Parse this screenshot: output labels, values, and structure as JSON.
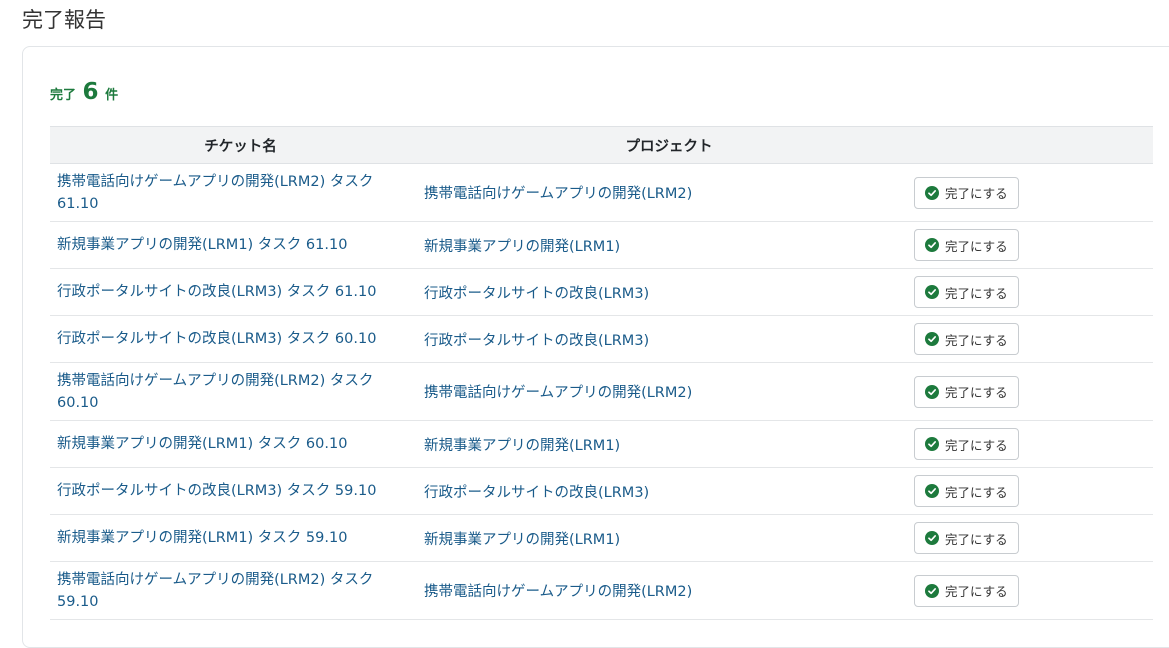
{
  "page": {
    "title": "完了報告"
  },
  "summary": {
    "prefix": "完了",
    "count": "6",
    "suffix": "件"
  },
  "table": {
    "headers": {
      "ticket": "チケット名",
      "project": "プロジェクト",
      "action": ""
    },
    "rows": [
      {
        "ticket": "携帯電話向けゲームアプリの開発(LRM2) タスク 61.10",
        "project": "携帯電話向けゲームアプリの開発(LRM2)",
        "action": "完了にする"
      },
      {
        "ticket": "新規事業アプリの開発(LRM1) タスク 61.10",
        "project": "新規事業アプリの開発(LRM1)",
        "action": "完了にする"
      },
      {
        "ticket": "行政ポータルサイトの改良(LRM3) タスク 61.10",
        "project": "行政ポータルサイトの改良(LRM3)",
        "action": "完了にする"
      },
      {
        "ticket": "行政ポータルサイトの改良(LRM3) タスク 60.10",
        "project": "行政ポータルサイトの改良(LRM3)",
        "action": "完了にする"
      },
      {
        "ticket": "携帯電話向けゲームアプリの開発(LRM2) タスク 60.10",
        "project": "携帯電話向けゲームアプリの開発(LRM2)",
        "action": "完了にする"
      },
      {
        "ticket": "新規事業アプリの開発(LRM1) タスク 60.10",
        "project": "新規事業アプリの開発(LRM1)",
        "action": "完了にする"
      },
      {
        "ticket": "行政ポータルサイトの改良(LRM3) タスク 59.10",
        "project": "行政ポータルサイトの改良(LRM3)",
        "action": "完了にする"
      },
      {
        "ticket": "新規事業アプリの開発(LRM1) タスク 59.10",
        "project": "新規事業アプリの開発(LRM1)",
        "action": "完了にする"
      },
      {
        "ticket": "携帯電話向けゲームアプリの開発(LRM2) タスク 59.10",
        "project": "携帯電話向けゲームアプリの開発(LRM2)",
        "action": "完了にする"
      }
    ]
  },
  "colors": {
    "accent_green": "#1d7a3d",
    "link_blue": "#1a5b8a"
  },
  "icons": {
    "complete": "check-circle-icon"
  }
}
